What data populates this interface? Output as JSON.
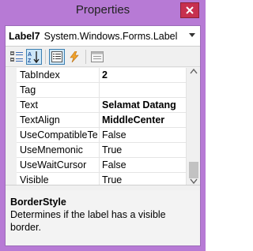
{
  "window": {
    "title": "Properties",
    "accent_color": "#b77ad5",
    "close_button_color": "#c7304f"
  },
  "selector": {
    "object_name": "Label7",
    "object_type": "System.Windows.Forms.Label"
  },
  "toolbar": {
    "buttons": [
      {
        "icon": "categorized-icon",
        "active": false
      },
      {
        "icon": "alphabetical-icon",
        "active": true
      },
      {
        "icon": "properties-icon",
        "active": true
      },
      {
        "icon": "events-lightning-icon",
        "active": false
      },
      {
        "icon": "property-pages-icon",
        "active": false
      }
    ]
  },
  "properties": [
    {
      "name": "TabIndex",
      "value": "2",
      "bold": true
    },
    {
      "name": "Tag",
      "value": "",
      "bold": false
    },
    {
      "name": "Text",
      "value": "Selamat Datang",
      "bold": true
    },
    {
      "name": "TextAlign",
      "value": "MiddleCenter",
      "bold": true
    },
    {
      "name": "UseCompatibleTex",
      "value": "False",
      "bold": false
    },
    {
      "name": "UseMnemonic",
      "value": "True",
      "bold": false
    },
    {
      "name": "UseWaitCursor",
      "value": "False",
      "bold": false
    },
    {
      "name": "Visible",
      "value": "True",
      "bold": false
    }
  ],
  "description": {
    "title": "BorderStyle",
    "text": "Determines if the label has a visible border."
  }
}
